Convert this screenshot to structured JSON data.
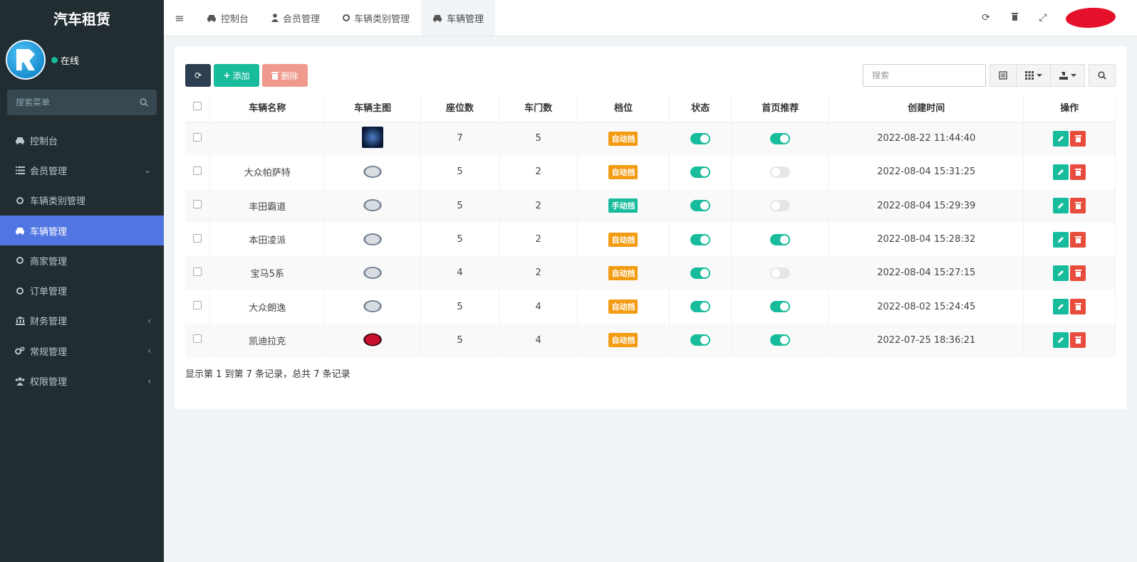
{
  "app": {
    "title": "汽车租赁"
  },
  "user": {
    "status": "在线"
  },
  "sidebar": {
    "search_placeholder": "搜索菜单",
    "items": [
      {
        "label": "控制台",
        "icon": "car-icon",
        "active": false,
        "arrow": ""
      },
      {
        "label": "会员管理",
        "icon": "list-icon",
        "active": false,
        "arrow": "⌄"
      },
      {
        "label": "车辆类别管理",
        "icon": "circle-icon",
        "active": false,
        "arrow": ""
      },
      {
        "label": "车辆管理",
        "icon": "car-icon",
        "active": true,
        "arrow": ""
      },
      {
        "label": "商家管理",
        "icon": "circle-icon",
        "active": false,
        "arrow": ""
      },
      {
        "label": "订单管理",
        "icon": "circle-icon",
        "active": false,
        "arrow": ""
      },
      {
        "label": "财务管理",
        "icon": "bank-icon",
        "active": false,
        "arrow": "‹"
      },
      {
        "label": "常规管理",
        "icon": "cogs-icon",
        "active": false,
        "arrow": "‹"
      },
      {
        "label": "权限管理",
        "icon": "group-icon",
        "active": false,
        "arrow": "‹"
      }
    ]
  },
  "header": {
    "tabs": [
      {
        "label": "控制台",
        "icon": "car-icon"
      },
      {
        "label": "会员管理",
        "icon": "user-icon"
      },
      {
        "label": "车辆类别管理",
        "icon": "circle-icon"
      },
      {
        "label": "车辆管理",
        "icon": "car-icon"
      }
    ]
  },
  "toolbar": {
    "add_label": "添加",
    "delete_label": "删除",
    "search_placeholder": "搜索"
  },
  "table": {
    "columns": [
      "车辆名称",
      "车辆主图",
      "座位数",
      "车门数",
      "档位",
      "状态",
      "首页推荐",
      "创建时间",
      "操作"
    ],
    "rows": [
      {
        "name": "",
        "image": "dark",
        "seats": "7",
        "doors": "5",
        "gear": "自动挡",
        "gear_type": "auto",
        "status": true,
        "recommend": true,
        "created": "2022-08-22 11:44:40"
      },
      {
        "name": "大众帕萨特",
        "image": "white",
        "seats": "5",
        "doors": "2",
        "gear": "自动挡",
        "gear_type": "auto",
        "status": true,
        "recommend": false,
        "created": "2022-08-04 15:31:25"
      },
      {
        "name": "丰田霸道",
        "image": "white",
        "seats": "5",
        "doors": "2",
        "gear": "手动挡",
        "gear_type": "manual",
        "status": true,
        "recommend": false,
        "created": "2022-08-04 15:29:39"
      },
      {
        "name": "本田凌派",
        "image": "white",
        "seats": "5",
        "doors": "2",
        "gear": "自动挡",
        "gear_type": "auto",
        "status": true,
        "recommend": true,
        "created": "2022-08-04 15:28:32"
      },
      {
        "name": "宝马5系",
        "image": "white",
        "seats": "4",
        "doors": "2",
        "gear": "自动挡",
        "gear_type": "auto",
        "status": true,
        "recommend": false,
        "created": "2022-08-04 15:27:15"
      },
      {
        "name": "大众朗逸",
        "image": "white",
        "seats": "5",
        "doors": "4",
        "gear": "自动挡",
        "gear_type": "auto",
        "status": true,
        "recommend": true,
        "created": "2022-08-02 15:24:45"
      },
      {
        "name": "凯迪拉克",
        "image": "red",
        "seats": "5",
        "doors": "4",
        "gear": "自动挡",
        "gear_type": "auto",
        "status": true,
        "recommend": true,
        "created": "2022-07-25 18:36:21"
      }
    ]
  },
  "pagination": {
    "summary": "显示第 1 到第 7 条记录，总共 7 条记录"
  },
  "colors": {
    "sidebar_bg": "#222d32",
    "active": "#5276e1",
    "success": "#18bc9c",
    "warning": "#f39c12",
    "danger": "#e74c3c"
  }
}
